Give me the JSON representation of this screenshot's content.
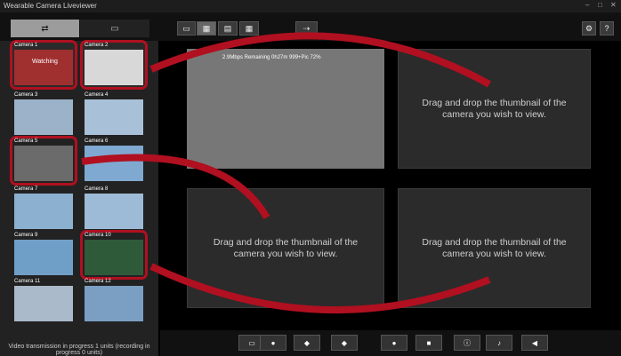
{
  "window": {
    "title": "Wearable Camera Liveviewer",
    "minimize": "–",
    "maximize": "□",
    "close": "✕"
  },
  "toolbar": {
    "layout_1": "▭",
    "layout_4": "▦",
    "layout_9": "▤",
    "layout_16": "▦",
    "transfer": "⇢",
    "settings": "⚙",
    "help": "?"
  },
  "sidebar": {
    "tab_cameras": "⇄",
    "tab_folder": "▭",
    "cameras": [
      {
        "label": "Camera 1",
        "status": "Watching"
      },
      {
        "label": "Camera 2"
      },
      {
        "label": "Camera 3"
      },
      {
        "label": "Camera 4"
      },
      {
        "label": "Camera 5"
      },
      {
        "label": "Camera 6"
      },
      {
        "label": "Camera 7"
      },
      {
        "label": "Camera 8"
      },
      {
        "label": "Camera 9"
      },
      {
        "label": "Camera 10"
      },
      {
        "label": "Camera 11"
      },
      {
        "label": "Camera 12"
      }
    ],
    "progress": "Video transmission in progress 1 units (recording in progress 0 units)"
  },
  "main": {
    "status_bar": "2.9Mbps  Remaining 0h27m  999+Pic  72%",
    "drop_hint": "Drag and drop the thumbnail of the camera you wish to view."
  },
  "bottom": {
    "buttons": [
      "▭",
      "●",
      "◆",
      "◆",
      "●",
      "■",
      "ⓘ",
      "♪",
      "◀"
    ]
  }
}
